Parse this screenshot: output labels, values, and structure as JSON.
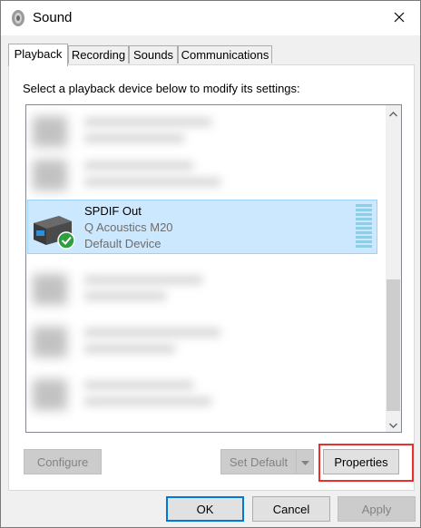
{
  "window": {
    "title": "Sound",
    "close_label": "✕"
  },
  "tabs": [
    {
      "label": "Playback",
      "active": true
    },
    {
      "label": "Recording",
      "active": false
    },
    {
      "label": "Sounds",
      "active": false
    },
    {
      "label": "Communications",
      "active": false
    }
  ],
  "playback": {
    "instruction": "Select a playback device below to modify its settings:",
    "selected_device": {
      "name": "SPDIF Out",
      "model": "Q Acoustics M20",
      "status": "Default Device",
      "icon": "speaker-icon",
      "status_icon": "checkmark-badge-icon"
    },
    "buttons": {
      "configure": "Configure",
      "set_default": "Set Default",
      "properties": "Properties"
    }
  },
  "footer": {
    "ok": "OK",
    "cancel": "Cancel",
    "apply": "Apply"
  },
  "colors": {
    "selection": "#cce8ff",
    "selection_border": "#99d1ff",
    "highlight_box": "#e8302f",
    "default_button_border": "#0078d7"
  }
}
